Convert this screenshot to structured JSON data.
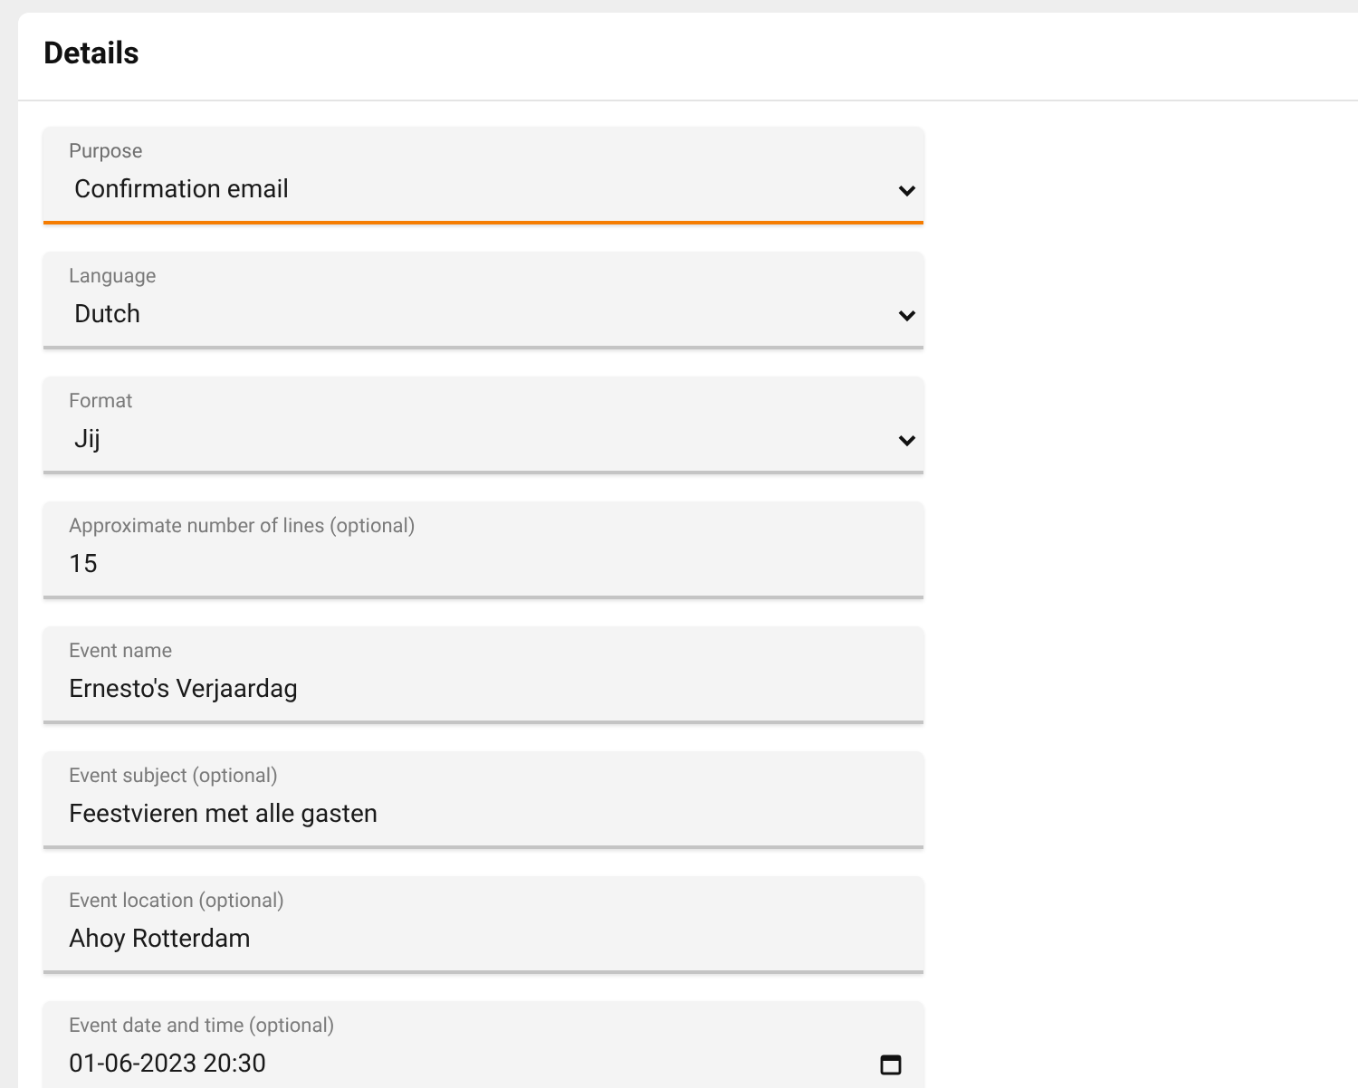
{
  "card": {
    "title": "Details"
  },
  "fields": [
    {
      "kind": "select",
      "label": "Purpose",
      "value": "Confirmation email",
      "focused": true
    },
    {
      "kind": "select",
      "label": "Language",
      "value": "Dutch",
      "focused": false
    },
    {
      "kind": "select",
      "label": "Format",
      "value": "Jij",
      "focused": false
    },
    {
      "kind": "text",
      "label": "Approximate number of lines (optional)",
      "value": "15",
      "focused": false
    },
    {
      "kind": "text",
      "label": "Event name",
      "value": "Ernesto's Verjaardag",
      "focused": false
    },
    {
      "kind": "text",
      "label": "Event subject (optional)",
      "value": "Feestvieren met alle gasten",
      "focused": false
    },
    {
      "kind": "text",
      "label": "Event location (optional)",
      "value": "Ahoy Rotterdam",
      "focused": false
    },
    {
      "kind": "datetime",
      "label": "Event date and time (optional)",
      "value": "01-06-2023 20:30",
      "focused": false
    }
  ]
}
